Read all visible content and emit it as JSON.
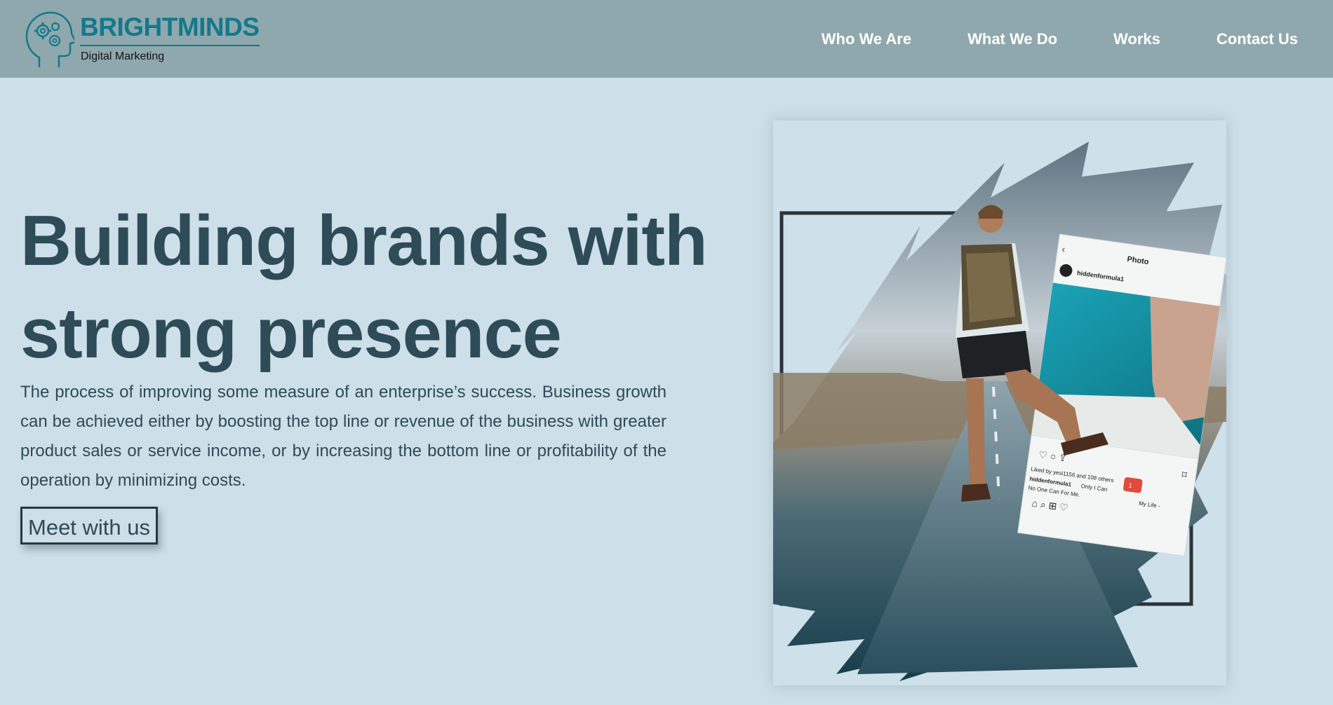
{
  "brand": {
    "name": "BRIGHTMINDS",
    "tagline": "Digital Marketing",
    "logo_icon": "head-gears-icon",
    "color": "#13798a"
  },
  "nav": {
    "items": [
      {
        "label": "Who We Are"
      },
      {
        "label": "What We Do"
      },
      {
        "label": "Works"
      },
      {
        "label": "Contact Us"
      }
    ]
  },
  "hero": {
    "headline_line1": "Building brands with",
    "headline_line2": "strong presence",
    "description": "The process of improving some measure of an enterprise’s success. Business growth can be achieved either by boosting the top line or revenue of the business with greater product sales or service income, or by increasing the bottom line or profitability of the operation by minimizing costs.",
    "cta_label": "Meet with us"
  },
  "hero_image": {
    "post_header": "Photo",
    "username": "hiddenformula1",
    "likes_text": "Liked by yesi1156 and 108 others",
    "caption_user": "hiddenformula1",
    "caption_text": "Only I Can",
    "caption_text2": "No One Can For Me.",
    "caption_end": "My Life -",
    "notification_count": "1"
  },
  "colors": {
    "header_bg": "#8fa8ad",
    "page_bg": "#cddfe8",
    "text": "#2e4b58",
    "accent": "#13798a"
  }
}
